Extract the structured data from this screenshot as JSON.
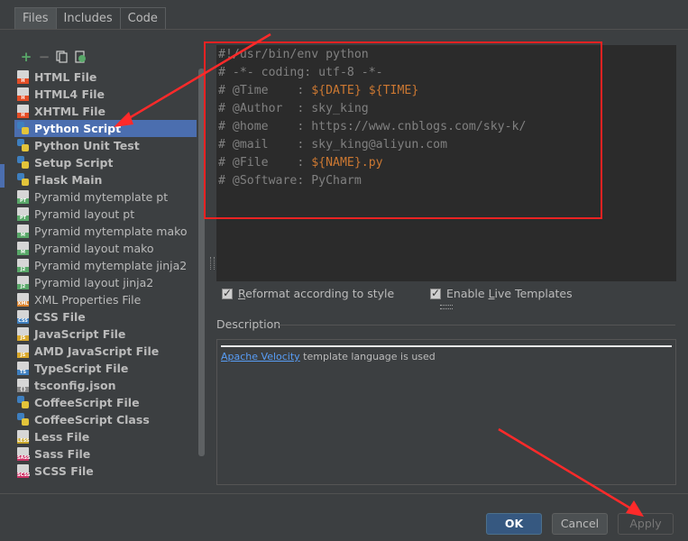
{
  "tabs": [
    "Files",
    "Includes",
    "Code"
  ],
  "toolbar": {
    "add": "+",
    "remove": "−"
  },
  "templates": [
    {
      "label": "HTML File",
      "badge": "H",
      "color": "#e44d26",
      "bold": true
    },
    {
      "label": "HTML4 File",
      "badge": "H",
      "color": "#e44d26",
      "bold": true
    },
    {
      "label": "XHTML File",
      "badge": "H",
      "color": "#e44d26",
      "bold": true
    },
    {
      "label": "Python Script",
      "badge": "",
      "color": "#3e7fbf",
      "bold": true,
      "selected": true,
      "py": true
    },
    {
      "label": "Python Unit Test",
      "badge": "",
      "color": "#3e7fbf",
      "bold": true,
      "py": true
    },
    {
      "label": "Setup Script",
      "badge": "",
      "color": "#3e7fbf",
      "bold": true,
      "py": true
    },
    {
      "label": "Flask Main",
      "badge": "",
      "color": "#3e7fbf",
      "bold": true,
      "py": true
    },
    {
      "label": "Pyramid mytemplate pt",
      "badge": "PT",
      "color": "#59a869",
      "bold": false
    },
    {
      "label": "Pyramid layout pt",
      "badge": "PT",
      "color": "#59a869",
      "bold": false
    },
    {
      "label": "Pyramid mytemplate mako",
      "badge": "M",
      "color": "#59a869",
      "bold": false
    },
    {
      "label": "Pyramid layout mako",
      "badge": "M",
      "color": "#59a869",
      "bold": false
    },
    {
      "label": "Pyramid mytemplate jinja2",
      "badge": "J2",
      "color": "#59a869",
      "bold": false
    },
    {
      "label": "Pyramid layout jinja2",
      "badge": "J2",
      "color": "#59a869",
      "bold": false
    },
    {
      "label": "XML Properties File",
      "badge": "XML",
      "color": "#d9822b",
      "bold": false
    },
    {
      "label": "CSS File",
      "badge": "CSS",
      "color": "#3e7fbf",
      "bold": true
    },
    {
      "label": "JavaScript File",
      "badge": "JS",
      "color": "#d9a82b",
      "bold": true
    },
    {
      "label": "AMD JavaScript File",
      "badge": "JS",
      "color": "#d9a82b",
      "bold": true
    },
    {
      "label": "TypeScript File",
      "badge": "TS",
      "color": "#3e7fbf",
      "bold": true
    },
    {
      "label": "tsconfig.json",
      "badge": "{}",
      "color": "#888888",
      "bold": true
    },
    {
      "label": "CoffeeScript File",
      "badge": "",
      "color": "#3e7fbf",
      "bold": true,
      "py": true
    },
    {
      "label": "CoffeeScript Class",
      "badge": "",
      "color": "#3e7fbf",
      "bold": true,
      "py": true
    },
    {
      "label": "Less File",
      "badge": "LESS",
      "color": "#c9a72c",
      "bold": true
    },
    {
      "label": "Sass File",
      "badge": "SASS",
      "color": "#cc3366",
      "bold": true
    },
    {
      "label": "SCSS File",
      "badge": "SCSS",
      "color": "#cc3366",
      "bold": true
    }
  ],
  "editor_lines": [
    [
      "#!/usr/bin/env python",
      ""
    ],
    [
      "# -*- coding: utf-8 -*-",
      ""
    ],
    [
      "# @Time    : ",
      "${DATE} ${TIME}"
    ],
    [
      "# @Author  : sky_king",
      ""
    ],
    [
      "# @home    : https://www.cnblogs.com/sky-k/",
      ""
    ],
    [
      "# @mail    : sky_king@aliyun.com",
      ""
    ],
    [
      "# @File    : ",
      "${NAME}.py"
    ],
    [
      "# @Software: PyCharm",
      ""
    ]
  ],
  "options": {
    "reformat": {
      "pre": "",
      "mnemonic": "R",
      "rest": "eformat according to style",
      "checked": true
    },
    "live": {
      "pre": "Enable ",
      "mnemonic": "L",
      "rest": "ive Templates",
      "checked": true
    }
  },
  "description": {
    "label": "Description",
    "link": "Apache Velocity",
    "text": " template language is used"
  },
  "buttons": {
    "ok": "OK",
    "cancel": "Cancel",
    "apply": "Apply"
  },
  "colors": {
    "selection": "#4b6eaf",
    "annotation": "#ff2a2a",
    "variable": "#cc7832",
    "link": "#589df6"
  }
}
